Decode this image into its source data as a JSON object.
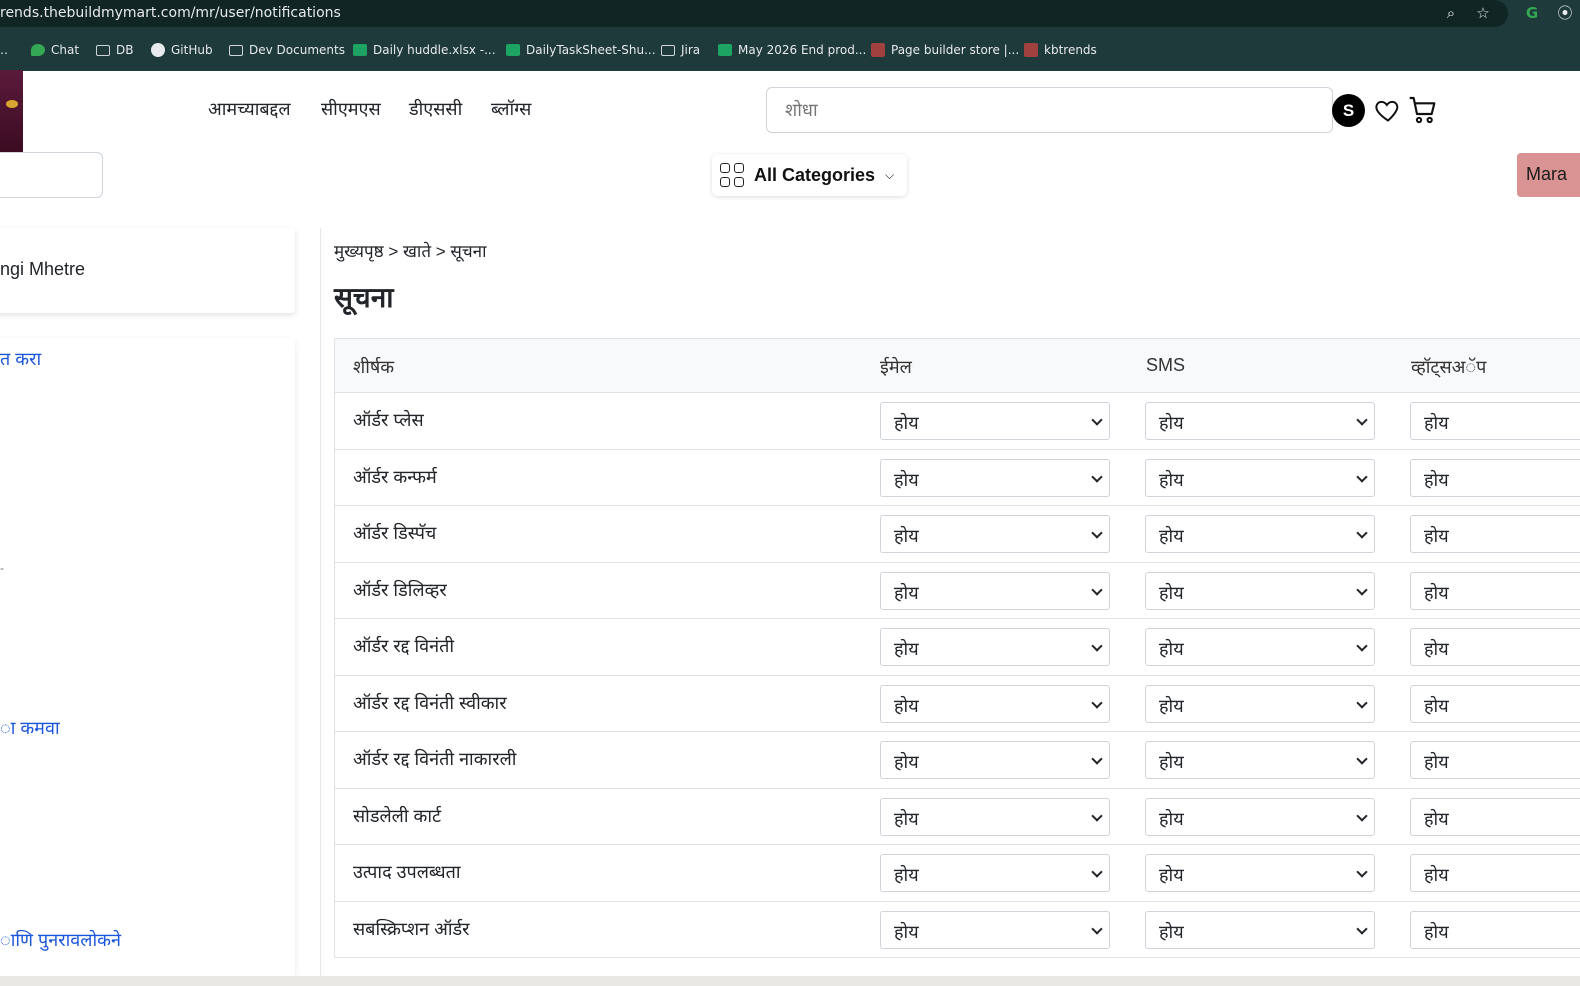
{
  "browser": {
    "url": "rends.thebuildmymart.com/mr/user/notifications",
    "bookmarks": [
      {
        "label": "Chat",
        "icon": "chat-icon"
      },
      {
        "label": "DB",
        "icon": "folder-icon"
      },
      {
        "label": "GitHub",
        "icon": "github-icon"
      },
      {
        "label": "Dev Documents",
        "icon": "folder-icon"
      },
      {
        "label": "Daily huddle.xlsx -...",
        "icon": "sheets-icon"
      },
      {
        "label": "DailyTaskSheet-Shu...",
        "icon": "sheets-icon"
      },
      {
        "label": "Jira",
        "icon": "folder-icon"
      },
      {
        "label": "May 2026 End prod...",
        "icon": "sheets-icon"
      },
      {
        "label": "Page builder store |...",
        "icon": "site-icon"
      },
      {
        "label": "kbtrends",
        "icon": "site-icon"
      }
    ]
  },
  "header": {
    "nav": [
      "आमच्याबद्दल",
      "सीएमएस",
      "डीएससी",
      "ब्लॉग्स"
    ],
    "search_placeholder": "शोधा",
    "avatar_letter": "S",
    "all_categories": "All Categories",
    "language": "Mara"
  },
  "sidebar": {
    "user_name": "ngi Mhetre",
    "links": [
      "त करा",
      "ा कमवा",
      "ाणि पुनरावलोकने"
    ],
    "dash": "-"
  },
  "content": {
    "breadcrumb": "मुख्यपृष्ठ > खाते > सूचना",
    "title": "सूचना",
    "columns": [
      "शीर्षक",
      "ईमेल",
      "SMS",
      "व्हॉट्सअॅप"
    ],
    "rows": [
      {
        "title": "ऑर्डर प्लेस",
        "email": "होय",
        "sms": "होय",
        "whatsapp": "होय"
      },
      {
        "title": "ऑर्डर कन्फर्म",
        "email": "होय",
        "sms": "होय",
        "whatsapp": "होय"
      },
      {
        "title": "ऑर्डर डिस्पॅच",
        "email": "होय",
        "sms": "होय",
        "whatsapp": "होय"
      },
      {
        "title": "ऑर्डर डिलिव्हर",
        "email": "होय",
        "sms": "होय",
        "whatsapp": "होय"
      },
      {
        "title": "ऑर्डर रद्द विनंती",
        "email": "होय",
        "sms": "होय",
        "whatsapp": "होय"
      },
      {
        "title": "ऑर्डर रद्द विनंती स्वीकार",
        "email": "होय",
        "sms": "होय",
        "whatsapp": "होय"
      },
      {
        "title": "ऑर्डर रद्द विनंती नाकारली",
        "email": "होय",
        "sms": "होय",
        "whatsapp": "होय"
      },
      {
        "title": "सोडलेली कार्ट",
        "email": "होय",
        "sms": "होय",
        "whatsapp": "होय"
      },
      {
        "title": "उत्पाद उपलब्धता",
        "email": "होय",
        "sms": "होय",
        "whatsapp": "होय"
      },
      {
        "title": "सबस्क्रिप्शन ऑर्डर",
        "email": "होय",
        "sms": "होय",
        "whatsapp": "होय"
      }
    ]
  },
  "colors": {
    "browser_bg": "#1e3a3a",
    "link": "#1a56db",
    "language_btn": "#d99393"
  }
}
